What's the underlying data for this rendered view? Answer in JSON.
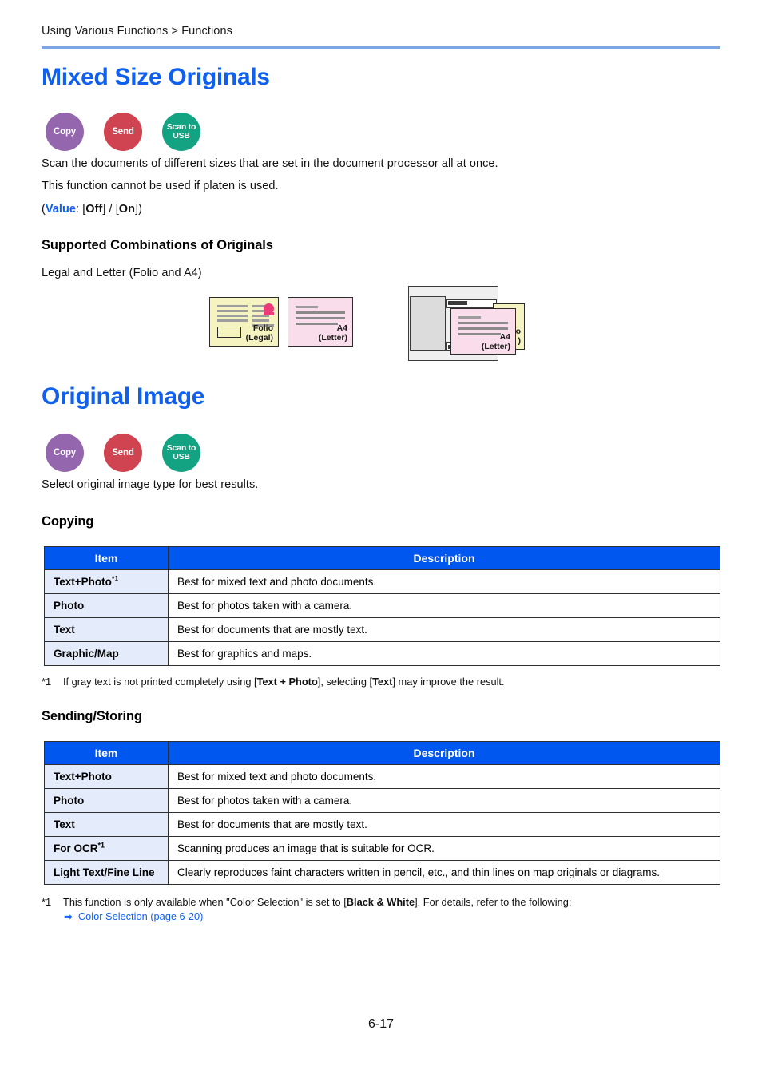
{
  "header": {
    "breadcrumb": "Using Various Functions > Functions"
  },
  "sections": [
    {
      "id": "mixed-size-originals",
      "title": "Mixed Size Originals",
      "badges": [
        {
          "name": "copy",
          "label": "Copy",
          "color": "#9466ad"
        },
        {
          "name": "send",
          "label": "Send",
          "color": "#cf4450"
        },
        {
          "name": "scan-to-usb",
          "label": "Scan to USB",
          "line1": "Scan to",
          "line2": "USB",
          "color": "#14a382"
        }
      ],
      "paragraphs": [
        "Scan the documents of different sizes that are set in the document processor all at once.",
        "This function cannot be used if platen is used."
      ],
      "value_line": {
        "open_paren": "(",
        "label": "Value",
        "colon": ": [",
        "option1": "Off",
        "separator": "] / [",
        "option2": "On",
        "close": "])"
      },
      "subheading": "Supported Combinations of Originals",
      "combination_text": "Legal and Letter (Folio and A4)",
      "illustration": {
        "sheet_folio_label_line1": "Folio",
        "sheet_folio_label_line2": "(Legal)",
        "sheet_a4_label_line1": "A4",
        "sheet_a4_label_line2": "(Letter)",
        "stacked_a4_label_line1": "A4",
        "stacked_a4_label_line2": "(Letter)",
        "stacked_folio_label_line1": "o",
        "stacked_folio_label_line2": ")"
      }
    },
    {
      "id": "original-image",
      "title": "Original Image",
      "badges": [
        {
          "name": "copy",
          "label": "Copy",
          "color": "#9466ad"
        },
        {
          "name": "send",
          "label": "Send",
          "color": "#cf4450"
        },
        {
          "name": "scan-to-usb",
          "label": "Scan to USB",
          "line1": "Scan to",
          "line2": "USB",
          "color": "#14a382"
        }
      ],
      "paragraphs": [
        "Select original image type for best results."
      ],
      "copying": {
        "subheading": "Copying",
        "columns": [
          "Item",
          "Description"
        ],
        "rows": [
          {
            "item": "Text+Photo",
            "footnote_marker": "*1",
            "description": "Best for mixed text and photo documents."
          },
          {
            "item": "Photo",
            "footnote_marker": "",
            "description": "Best for photos taken with a camera."
          },
          {
            "item": "Text",
            "footnote_marker": "",
            "description": "Best for documents that are mostly text."
          },
          {
            "item": "Graphic/Map",
            "footnote_marker": "",
            "description": "Best for graphics and maps."
          }
        ],
        "footnote": {
          "marker": "*1",
          "part1": "If gray text is not printed completely using [",
          "bold1": "Text + Photo",
          "part2": "], selecting [",
          "bold2": "Text",
          "part3": "] may improve the result."
        }
      },
      "sending_storing": {
        "subheading": "Sending/Storing",
        "columns": [
          "Item",
          "Description"
        ],
        "rows": [
          {
            "item": "Text+Photo",
            "footnote_marker": "",
            "description": "Best for mixed text and photo documents."
          },
          {
            "item": "Photo",
            "footnote_marker": "",
            "description": "Best for photos taken with a camera."
          },
          {
            "item": "Text",
            "footnote_marker": "",
            "description": "Best for documents that are mostly text."
          },
          {
            "item": "For OCR",
            "footnote_marker": "*1",
            "description": "Scanning produces an image that is suitable for OCR."
          },
          {
            "item": "Light Text/Fine Line",
            "footnote_marker": "",
            "description": "Clearly reproduces faint characters written in pencil, etc., and thin lines on map originals or diagrams."
          }
        ],
        "footnote": {
          "marker": "*1",
          "part1": "This function is only available when \"Color Selection\" is set to [",
          "bold1": "Black & White",
          "part2": "]. For details, refer to the following:",
          "link_arrow": "➡",
          "link_text": "Color Selection (page 6-20)"
        }
      }
    }
  ],
  "footer": {
    "page_number": "6-17"
  },
  "theme": {
    "heading_blue": "#1060f0",
    "table_header_blue": "#0057f0",
    "item_cell_blue": "#e4ecfb",
    "rule_blue": "#7ca5e6",
    "folio_paper": "#f5f3c0",
    "a4_paper": "#f9ddeb"
  }
}
